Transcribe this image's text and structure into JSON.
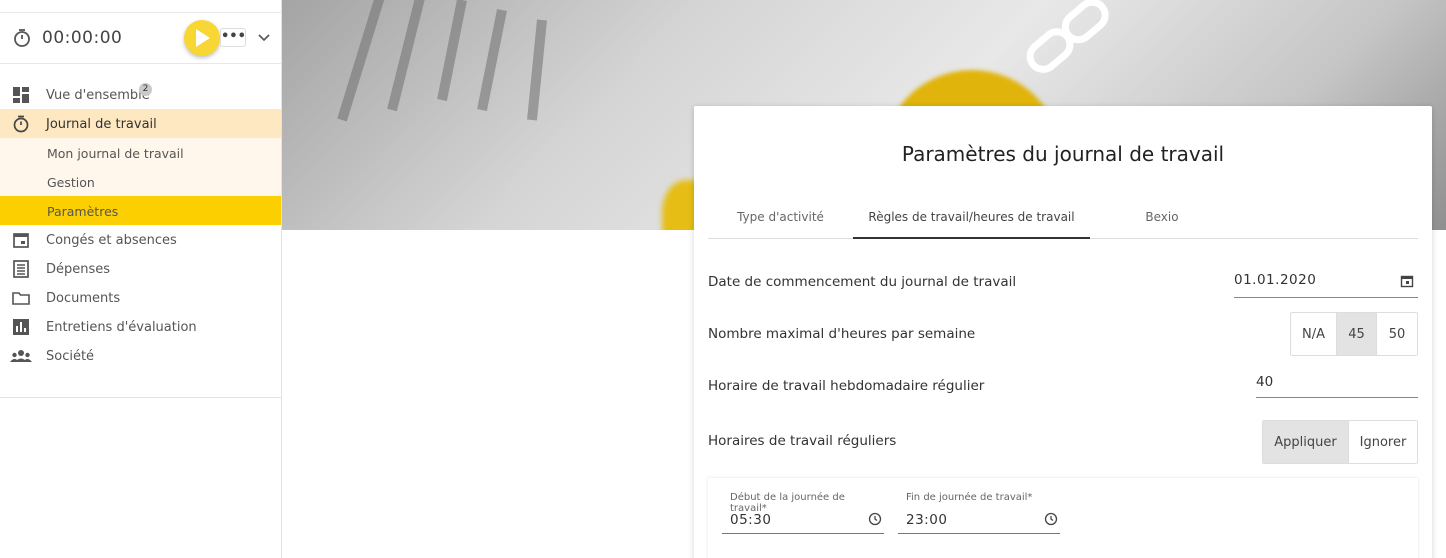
{
  "timer": {
    "value": "00:00:00",
    "more_label": "•••"
  },
  "sidebar": {
    "items": [
      {
        "label": "Vue d'ensemble",
        "badge": "2"
      },
      {
        "label": "Journal de travail"
      },
      {
        "label": "Mon journal de travail"
      },
      {
        "label": "Gestion"
      },
      {
        "label": "Paramètres"
      },
      {
        "label": "Congés et absences"
      },
      {
        "label": "Dépenses"
      },
      {
        "label": "Documents"
      },
      {
        "label": "Entretiens d'évaluation"
      },
      {
        "label": "Société"
      }
    ]
  },
  "card": {
    "title": "Paramètres du journal de travail",
    "tabs": [
      {
        "label": "Type d'activité"
      },
      {
        "label": "Règles de travail/heures de travail"
      },
      {
        "label": "Bexio"
      }
    ],
    "start_date": {
      "label": "Date de commencement du journal de travail",
      "value": "01.01.2020"
    },
    "max_hours": {
      "label": "Nombre maximal d'heures par semaine",
      "options": [
        "N/A",
        "45",
        "50"
      ],
      "selected": "45"
    },
    "weekly_hours": {
      "label": "Horaire de travail hebdomadaire régulier",
      "value": "40"
    },
    "regular_hours": {
      "label": "Horaires de travail réguliers",
      "options": [
        "Appliquer",
        "Ignorer"
      ],
      "selected": "Appliquer"
    },
    "day_start": {
      "label": "Début de la journée de travail*",
      "value": "05:30"
    },
    "day_end": {
      "label": "Fin de journée de travail*",
      "value": "23:00"
    }
  },
  "colors": {
    "accent": "#fccf00",
    "active_bg": "#fde8c2",
    "sub_bg": "#fff7ec"
  }
}
